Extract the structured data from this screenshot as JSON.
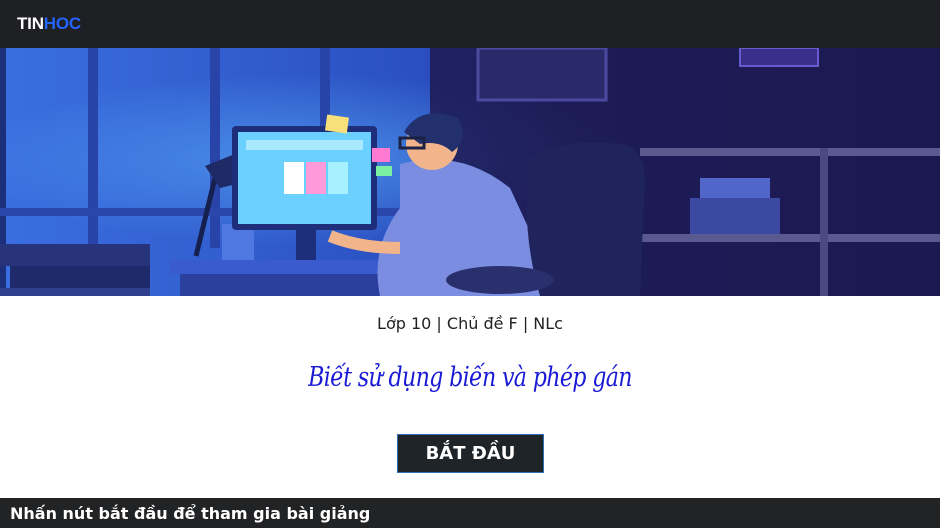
{
  "header": {
    "logo_part1": "TIN",
    "logo_part2": "HOC"
  },
  "hero": {
    "image": "developer-at-night-illustration"
  },
  "course": {
    "subtitle": "Lớp 10 | Chủ đề F | NLc",
    "title": "Biết sử dụng biến và phép gán"
  },
  "actions": {
    "start_label": "BẮT ĐẦU"
  },
  "footer": {
    "hint": "Nhấn nút bắt đầu để tham gia bài giảng"
  },
  "colors": {
    "topbar": "#1f2023",
    "logo_accent": "#2563ff",
    "title": "#1a1ad4",
    "button": "#1f2428"
  }
}
